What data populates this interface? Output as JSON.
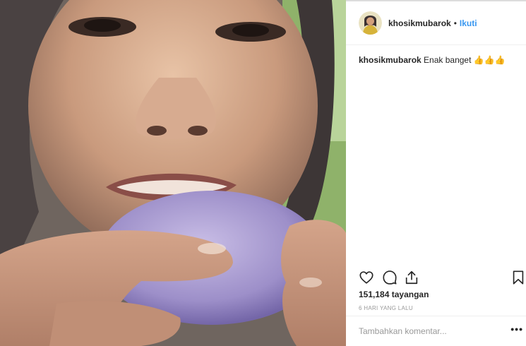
{
  "post": {
    "username": "khosikmubarok",
    "separator": "•",
    "follow_label": "Ikuti",
    "caption_user": "khosikmubarok",
    "caption_text": "Enak banget 👍👍👍",
    "views_count": "151,184",
    "views_label": "tayangan",
    "timestamp": "6 HARI YANG LALU"
  },
  "comment_box": {
    "placeholder": "Tambahkan komentar...",
    "more_label": "•••"
  },
  "icons": {
    "like": "heart-icon",
    "comment": "comment-bubble-icon",
    "share": "share-icon",
    "save": "bookmark-icon"
  },
  "colors": {
    "link": "#3897f0",
    "text": "#262626",
    "muted": "#999999",
    "divider": "#efefef"
  }
}
